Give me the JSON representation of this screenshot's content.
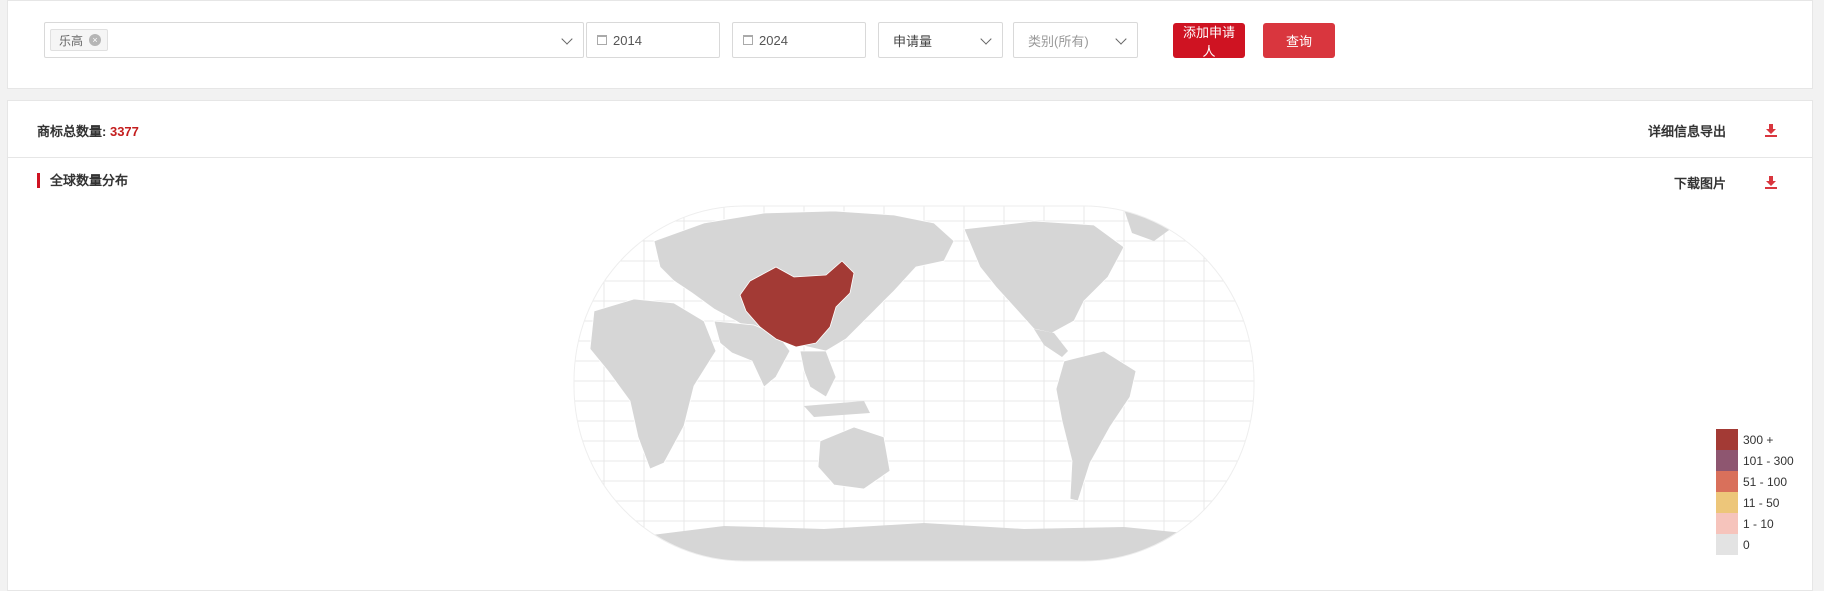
{
  "filters": {
    "applicant_tag": "乐高",
    "tag_remove_symbol": "×",
    "start_year": "2014",
    "end_year": "2024",
    "metric_select": "申请量",
    "category_select_placeholder": "类别(所有)",
    "add_applicant_label": "添加申请人",
    "query_label": "查询"
  },
  "summary": {
    "total_label": "商标总数量:",
    "total_count": "3377",
    "export_label": "详细信息导出"
  },
  "map_section": {
    "title": "全球数量分布",
    "download_image_label": "下载图片",
    "highlighted_country": "China",
    "highlight_color": "#a33a35",
    "base_land_color": "#d6d6d6"
  },
  "legend": [
    {
      "label": "300 +",
      "color": "#a33a35"
    },
    {
      "label": "101 - 300",
      "color": "#8e5670"
    },
    {
      "label": "51 - 100",
      "color": "#d9705b"
    },
    {
      "label": "11 - 50",
      "color": "#edc67a"
    },
    {
      "label": "1 - 10",
      "color": "#f6c4bc"
    },
    {
      "label": "0",
      "color": "#e3e3e3"
    }
  ],
  "colors": {
    "accent": "#cf1322",
    "query_button": "#d9363e",
    "count_text": "#c41d1d"
  }
}
